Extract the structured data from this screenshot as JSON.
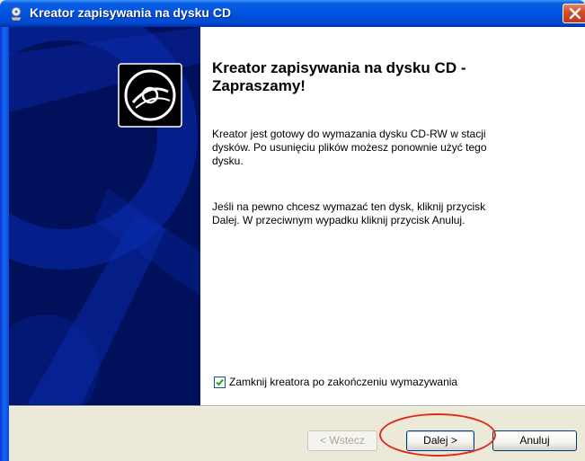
{
  "window": {
    "title": "Kreator zapisywania na dysku CD",
    "title_icon": "cd-burn-icon",
    "close_icon": "close-icon",
    "accent_color": "#0054e3",
    "close_color": "#d44d2c"
  },
  "banner": {
    "icon": "cd-disc-icon",
    "background_color": "#00105b"
  },
  "content": {
    "heading": "Kreator zapisywania na dysku CD -\nZapraszamy!",
    "paragraph1": "Kreator jest gotowy do wymazania dysku CD-RW w stacji\ndysków. Po usunięciu plików możesz ponownie użyć tego\ndysku.",
    "paragraph2": "Jeśli na pewno chcesz wymazać ten dysk, kliknij przycisk\nDalej. W przeciwnym wypadku kliknij przycisk Anuluj."
  },
  "options": {
    "close_wizard_label": "Zamknij kreatora po zakończeniu wymazywania",
    "close_wizard_checked": true
  },
  "buttons": {
    "back_label": "< Wstecz",
    "back_enabled": false,
    "next_label": "Dalej >",
    "cancel_label": "Anuluj"
  },
  "annotation": {
    "highlight_color": "#e02a1a",
    "highlighted": "next-button"
  }
}
